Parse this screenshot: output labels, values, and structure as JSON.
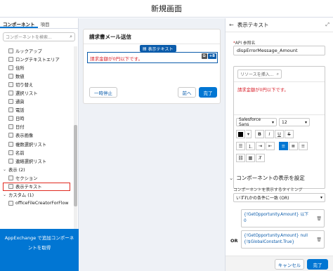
{
  "window": {
    "title": "新規画面"
  },
  "left_panel": {
    "tabs": [
      "コンポーネント",
      "項目"
    ],
    "search_placeholder": "コンポーネントを検索...",
    "items": [
      {
        "type": "item",
        "label": "ルックアップ"
      },
      {
        "type": "item",
        "label": "ロングテキストエリア"
      },
      {
        "type": "item",
        "label": "住所"
      },
      {
        "type": "item",
        "label": "数値"
      },
      {
        "type": "item",
        "label": "切り替え"
      },
      {
        "type": "item",
        "label": "選択リスト"
      },
      {
        "type": "item",
        "label": "通貨"
      },
      {
        "type": "item",
        "label": "電話"
      },
      {
        "type": "item",
        "label": "日時"
      },
      {
        "type": "item",
        "label": "日付"
      },
      {
        "type": "item",
        "label": "表示画像"
      },
      {
        "type": "item",
        "label": "複数選択リスト"
      },
      {
        "type": "item",
        "label": "名前"
      },
      {
        "type": "item",
        "label": "連絡選択リスト"
      },
      {
        "type": "group",
        "label": "表示 (2)"
      },
      {
        "type": "item",
        "label": "セクション"
      },
      {
        "type": "item",
        "label": "表示テキスト",
        "highlight": true
      },
      {
        "type": "group",
        "label": "カスタム (1)"
      },
      {
        "type": "item",
        "label": "officeFileCreatorForFlow"
      }
    ],
    "appexchange_line1": "AppExchange で追加コンポーネ",
    "appexchange_line2": "ントを取得"
  },
  "canvas": {
    "screen_title": "請求書メール送信",
    "component_tag": "表示テキスト",
    "error_text": "請求金額が0円以下です。",
    "copy_tool": "⧉",
    "add_tool": "+8",
    "pause_label": "一時停止",
    "prev_label": "前へ",
    "finish_label": "完了"
  },
  "right_panel": {
    "header": "表示テキスト",
    "api_label": "API 参照名",
    "api_value": "dispErrorMessage_Amount",
    "resource_placeholder": "リソースを挿入...",
    "body_text": "請求金額が0円以下です。",
    "font_family": "Salesforce Sans",
    "font_size": "12",
    "format_buttons": [
      "B",
      "I",
      "U",
      "S"
    ],
    "align_buttons": [
      "≡",
      "≣",
      "≡",
      "≡"
    ],
    "link_buttons": [
      "🔗",
      "▦",
      "Tx"
    ],
    "section_title": "コンポーネントの表示を設定",
    "timing_label": "コンポーネントを表示するタイミング",
    "timing_value": "いずれかの条件に一致 (OR)",
    "condition1_line1": "{!GetOpportunity.Amount} 以下",
    "condition1_line2": "0",
    "or_label": "OR",
    "condition2_line1": "{!GetOpportunity.Amount} null",
    "condition2_line2": "{!$GlobalConstant.True}",
    "cancel_label": "キャンセル",
    "done_label": "完了"
  },
  "colors": {
    "brand": "#0176d3",
    "error": "#d9232d",
    "highlight": "#e0291f"
  }
}
